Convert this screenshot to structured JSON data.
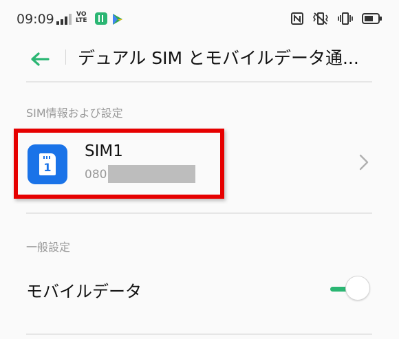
{
  "status_bar": {
    "time": "09:09",
    "volte_top": "VO",
    "volte_bottom": "LTE",
    "icons": [
      "signal-icon",
      "volte-icon",
      "app-icon",
      "play-store-icon",
      "nfc-icon",
      "vibrate-icon",
      "vibrate-mode-icon",
      "battery-icon"
    ]
  },
  "header": {
    "title": "デュアル SIM とモバイルデータ通..."
  },
  "sections": {
    "sim_info": "SIM情報および設定",
    "general": "一般設定"
  },
  "sim1": {
    "card_number": "1",
    "title": "SIM1",
    "number_prefix": "080"
  },
  "mobile_data": {
    "label": "モバイルデータ",
    "enabled": true
  },
  "colors": {
    "accent": "#2bb673",
    "sim_icon": "#1a73e8",
    "highlight": "#e60000"
  }
}
